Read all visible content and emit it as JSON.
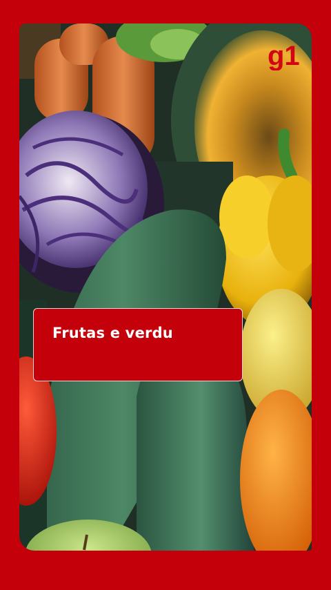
{
  "brand": {
    "logo_text": "g1",
    "accent_color": "#c4000a"
  },
  "caption": {
    "text": "Frutas e verdu"
  },
  "photo": {
    "subject_icons": [
      "carrot",
      "red-cabbage",
      "pumpkin",
      "yellow-pepper",
      "cucumber",
      "lemon",
      "orange",
      "tomato",
      "apple",
      "lettuce"
    ]
  }
}
